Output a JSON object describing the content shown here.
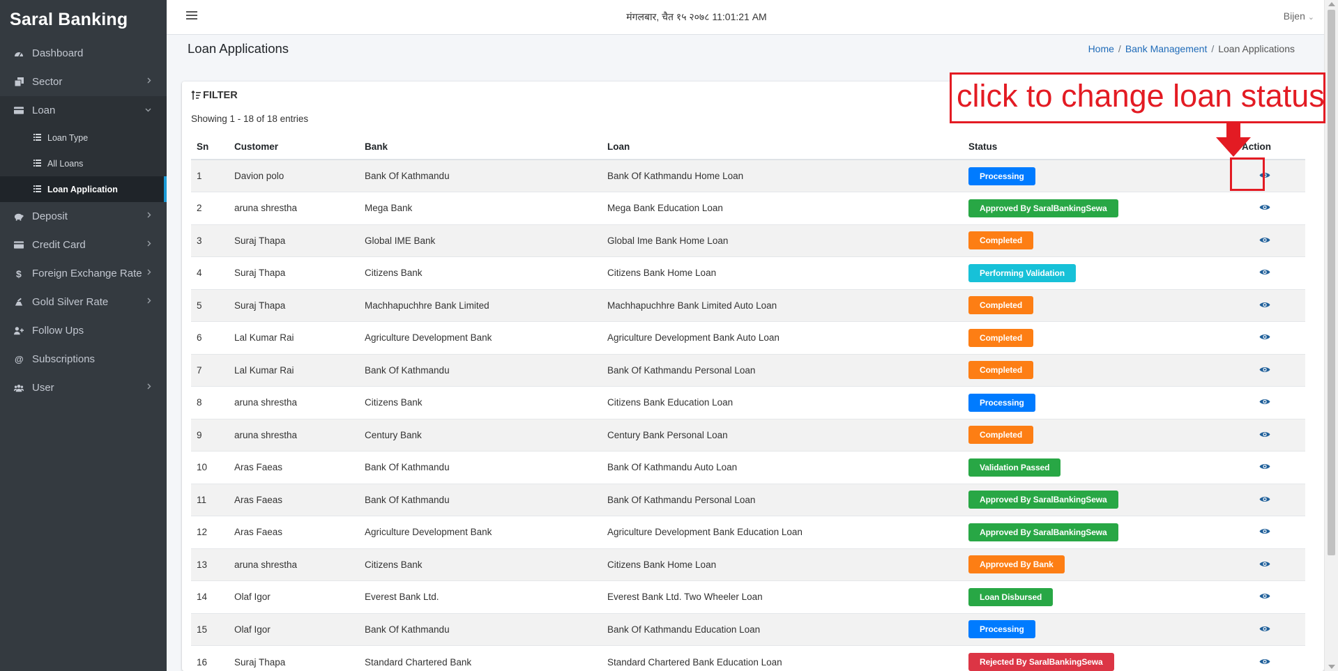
{
  "sidebar": {
    "brand": "Saral Banking",
    "items": [
      {
        "label": "Dashboard",
        "icon": "dashboard-icon",
        "chevron": false
      },
      {
        "label": "Sector",
        "icon": "copy-icon",
        "chevron": true
      },
      {
        "label": "Loan",
        "icon": "money-icon",
        "chevron": true,
        "open": true
      },
      {
        "label": "Deposit",
        "icon": "piggy-bank-icon",
        "chevron": true
      },
      {
        "label": "Credit Card",
        "icon": "credit-card-icon",
        "chevron": true
      },
      {
        "label": "Foreign Exchange Rate",
        "icon": "dollar-icon",
        "chevron": true
      },
      {
        "label": "Gold Silver Rate",
        "icon": "gold-icon",
        "chevron": true
      },
      {
        "label": "Follow Ups",
        "icon": "user-plus-icon",
        "chevron": false
      },
      {
        "label": "Subscriptions",
        "icon": "at-icon",
        "chevron": false
      },
      {
        "label": "User",
        "icon": "users-icon",
        "chevron": true
      }
    ],
    "loan_sub": [
      {
        "label": "Loan Type",
        "active": false
      },
      {
        "label": "All Loans",
        "active": false
      },
      {
        "label": "Loan Application",
        "active": true
      }
    ]
  },
  "topbar": {
    "datetime": "मंगलबार, चैत १५ २०७८ 11:01:21 AM",
    "user": "Bijen",
    "user_caret": "⌄"
  },
  "page": {
    "title": "Loan Applications",
    "breadcrumb": {
      "home": "Home",
      "section": "Bank Management",
      "current": "Loan Applications",
      "sep": "/"
    }
  },
  "card": {
    "filter_label": "FILTER",
    "showing": "Showing 1 - 18 of 18 entries"
  },
  "table": {
    "headers": {
      "sn": "Sn",
      "customer": "Customer",
      "bank": "Bank",
      "loan": "Loan",
      "status": "Status",
      "action": "Action"
    },
    "rows": [
      {
        "sn": "1",
        "customer": "Davion polo",
        "bank": "Bank Of Kathmandu",
        "loan": "Bank Of Kathmandu Home Loan",
        "status": "Processing",
        "status_color": "#007bff"
      },
      {
        "sn": "2",
        "customer": "aruna shrestha",
        "bank": "Mega Bank",
        "loan": "Mega Bank Education Loan",
        "status": "Approved By SaralBankingSewa",
        "status_color": "#28a745"
      },
      {
        "sn": "3",
        "customer": "Suraj Thapa",
        "bank": "Global IME Bank",
        "loan": "Global Ime Bank Home Loan",
        "status": "Completed",
        "status_color": "#fd7e14"
      },
      {
        "sn": "4",
        "customer": "Suraj Thapa",
        "bank": "Citizens Bank",
        "loan": "Citizens Bank Home Loan",
        "status": "Performing Validation",
        "status_color": "#17c1d8"
      },
      {
        "sn": "5",
        "customer": "Suraj Thapa",
        "bank": "Machhapuchhre Bank Limited",
        "loan": "Machhapuchhre Bank Limited Auto Loan",
        "status": "Completed",
        "status_color": "#fd7e14"
      },
      {
        "sn": "6",
        "customer": "Lal Kumar Rai",
        "bank": "Agriculture Development Bank",
        "loan": "Agriculture Development Bank Auto Loan",
        "status": "Completed",
        "status_color": "#fd7e14"
      },
      {
        "sn": "7",
        "customer": "Lal Kumar Rai",
        "bank": "Bank Of Kathmandu",
        "loan": "Bank Of Kathmandu Personal Loan",
        "status": "Completed",
        "status_color": "#fd7e14"
      },
      {
        "sn": "8",
        "customer": "aruna shrestha",
        "bank": "Citizens Bank",
        "loan": "Citizens Bank Education Loan",
        "status": "Processing",
        "status_color": "#007bff"
      },
      {
        "sn": "9",
        "customer": "aruna shrestha",
        "bank": "Century Bank",
        "loan": "Century Bank Personal Loan",
        "status": "Completed",
        "status_color": "#fd7e14"
      },
      {
        "sn": "10",
        "customer": "Aras Faeas",
        "bank": "Bank Of Kathmandu",
        "loan": "Bank Of Kathmandu Auto Loan",
        "status": "Validation Passed",
        "status_color": "#28a745"
      },
      {
        "sn": "11",
        "customer": "Aras Faeas",
        "bank": "Bank Of Kathmandu",
        "loan": "Bank Of Kathmandu Personal Loan",
        "status": "Approved By SaralBankingSewa",
        "status_color": "#28a745"
      },
      {
        "sn": "12",
        "customer": "Aras Faeas",
        "bank": "Agriculture Development Bank",
        "loan": "Agriculture Development Bank Education Loan",
        "status": "Approved By SaralBankingSewa",
        "status_color": "#28a745"
      },
      {
        "sn": "13",
        "customer": "aruna shrestha",
        "bank": "Citizens Bank",
        "loan": "Citizens Bank Home Loan",
        "status": "Approved By Bank",
        "status_color": "#fd7e14"
      },
      {
        "sn": "14",
        "customer": "Olaf Igor",
        "bank": "Everest Bank Ltd.",
        "loan": "Everest Bank Ltd. Two Wheeler Loan",
        "status": "Loan Disbursed",
        "status_color": "#28a745"
      },
      {
        "sn": "15",
        "customer": "Olaf Igor",
        "bank": "Bank Of Kathmandu",
        "loan": "Bank Of Kathmandu Education Loan",
        "status": "Processing",
        "status_color": "#007bff"
      },
      {
        "sn": "16",
        "customer": "Suraj Thapa",
        "bank": "Standard Chartered Bank",
        "loan": "Standard Chartered Bank Education Loan",
        "status": "Rejected By SaralBankingSewa",
        "status_color": "#dc3545"
      }
    ]
  },
  "annotation": {
    "text": "click to change loan status",
    "color": "#e31b23"
  },
  "colors": {
    "sidebar_bg": "#343a40",
    "accent": "#1a9ad6",
    "link": "#1f6bb8",
    "eye_icon": "#1f5f99"
  }
}
